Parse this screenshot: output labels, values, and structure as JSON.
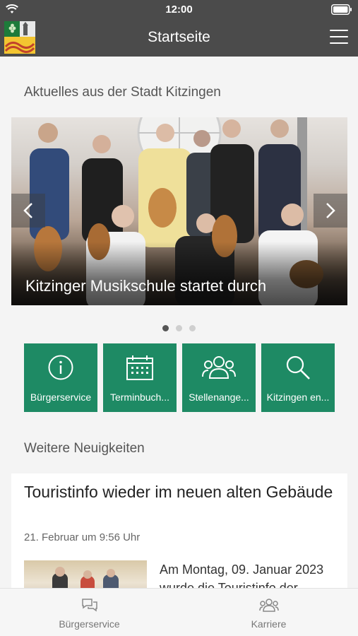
{
  "status_bar": {
    "time": "12:00"
  },
  "header": {
    "title": "Startseite",
    "logo_icon": "kitzingen-crest-icon",
    "menu_icon": "hamburger-menu-icon"
  },
  "news": {
    "section_title": "Aktuelles aus der Stadt Kitzingen",
    "slides": [
      {
        "caption": "Kitzinger Musikschule startet durch"
      }
    ],
    "slide_count": 3,
    "active_slide": 1
  },
  "quicklinks": [
    {
      "label": "Bürgerservice",
      "icon": "info-icon"
    },
    {
      "label": "Terminbuch...",
      "icon": "calendar-icon"
    },
    {
      "label": "Stellenange...",
      "icon": "people-icon"
    },
    {
      "label": "Kitzingen en...",
      "icon": "search-icon"
    }
  ],
  "more_news": {
    "section_title": "Weitere Neuigkeiten",
    "article": {
      "title": "Touristinfo wieder im neuen alten Gebäude",
      "date": "21. Februar um 9:56 Uhr",
      "excerpt": "Am Montag, 09. Januar 2023 wurde die Touristinfo der"
    }
  },
  "tabbar": [
    {
      "label": "Bürgerservice",
      "icon": "chat-bubbles-icon"
    },
    {
      "label": "Karriere",
      "icon": "people-icon"
    }
  ],
  "colors": {
    "header_bg": "#4b4b4b",
    "accent_green": "#1e8a64",
    "background": "#f4f4f4"
  }
}
